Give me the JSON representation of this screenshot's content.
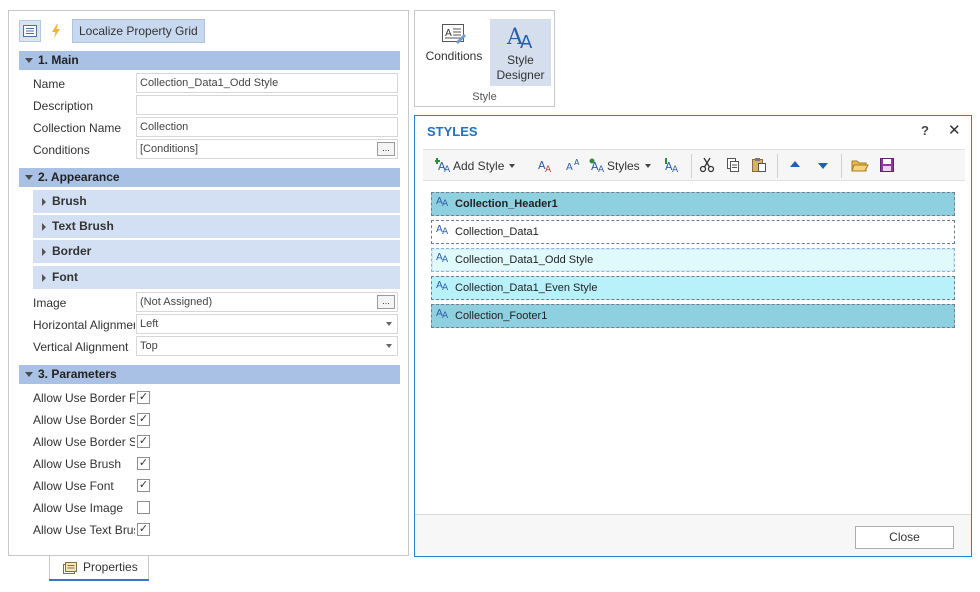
{
  "property_grid": {
    "toolbar": {
      "categorized_icon": "property-list-icon",
      "events_icon": "lightning-icon",
      "localize_label": "Localize Property Grid"
    },
    "sections": {
      "main": {
        "title": "1. Main",
        "props": [
          {
            "label": "Name",
            "value": "Collection_Data1_Odd Style"
          },
          {
            "label": "Description",
            "value": ""
          },
          {
            "label": "Collection Name",
            "value": "Collection"
          },
          {
            "label": "Conditions",
            "value": "[Conditions]",
            "button": "..."
          }
        ]
      },
      "appearance": {
        "title": "2. Appearance",
        "groups": [
          "Brush",
          "Text Brush",
          "Border",
          "Font"
        ],
        "props": [
          {
            "label": "Image",
            "value": "(Not Assigned)",
            "button": "..."
          },
          {
            "label": "Horizontal Alignment",
            "value": "Left"
          },
          {
            "label": "Vertical Alignment",
            "value": "Top"
          }
        ]
      },
      "parameters": {
        "title": "3. Parameters",
        "props": [
          {
            "label": "Allow Use Border Formatting",
            "checked": true
          },
          {
            "label": "Allow Use Border Sides",
            "checked": true
          },
          {
            "label": "Allow Use Border Sides",
            "checked": true
          },
          {
            "label": "Allow Use Brush",
            "checked": true
          },
          {
            "label": "Allow Use Font",
            "checked": true
          },
          {
            "label": "Allow Use Image",
            "checked": false
          },
          {
            "label": "Allow Use Text Brush",
            "checked": true
          }
        ]
      }
    },
    "tab_label": "Properties"
  },
  "ribbon": {
    "conditions_label": "Conditions",
    "style_designer_label_1": "Style",
    "style_designer_label_2": "Designer",
    "group_label": "Style"
  },
  "styles_dialog": {
    "title": "STYLES",
    "help": "?",
    "close_x": "✕",
    "toolbar": {
      "add_style": "Add Style",
      "styles": "Styles"
    },
    "rows": [
      {
        "name": "Collection_Header1",
        "bold": true,
        "bg": "#8fd0e0"
      },
      {
        "name": "Collection_Data1",
        "bold": false,
        "bg": "#ffffff"
      },
      {
        "name": "Collection_Data1_Odd Style",
        "bold": false,
        "bg": "#e0fafc"
      },
      {
        "name": "Collection_Data1_Even Style",
        "bold": false,
        "bg": "#b9f1fb"
      },
      {
        "name": "Collection_Footer1",
        "bold": false,
        "bg": "#8fd0e0"
      }
    ],
    "close_button": "Close"
  }
}
